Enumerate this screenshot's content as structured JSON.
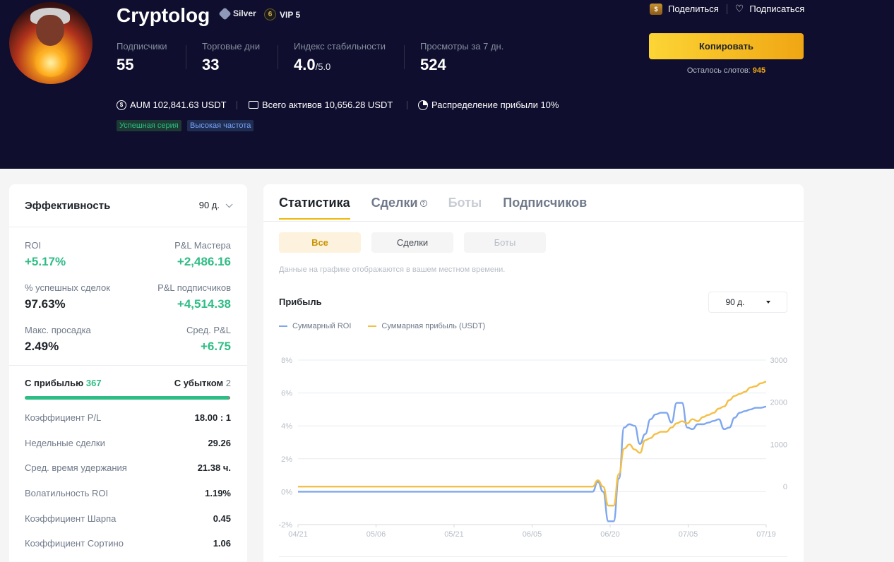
{
  "profile": {
    "name": "Cryptolog",
    "badge_silver": "Silver",
    "badge_vip": "VIP 5",
    "badge_vip_number": "6",
    "stats": [
      {
        "label": "Подписчики",
        "value": "55"
      },
      {
        "label": "Торговые дни",
        "value": "33"
      },
      {
        "label": "Индекс стабильности",
        "value": "4.0",
        "suffix": "/5.0"
      },
      {
        "label": "Просмотры за 7 дн.",
        "value": "524"
      }
    ],
    "aum": "AUM 102,841.63 USDT",
    "total_assets": "Всего активов 10,656.28 USDT",
    "profit_share": "Распределение прибыли 10%",
    "tags": [
      "Успешная серия",
      "Высокая частота"
    ]
  },
  "actions": {
    "share": "Поделиться",
    "subscribe": "Подписаться",
    "copy": "Копировать",
    "slots_label": "Осталось слотов: ",
    "slots_value": "945"
  },
  "performance": {
    "title": "Эффективность",
    "period": "90 д.",
    "metrics": [
      {
        "label": "ROI",
        "value": "+5.17%",
        "positive": true
      },
      {
        "label": "P&L Мастера",
        "value": "+2,486.16",
        "positive": true
      },
      {
        "label": "% успешных сделок",
        "value": "97.63%",
        "positive": false
      },
      {
        "label": "P&L подписчиков",
        "value": "+4,514.38",
        "positive": true
      },
      {
        "label": "Макс. просадка",
        "value": "2.49%",
        "positive": false
      },
      {
        "label": "Сред. P&L",
        "value": "+6.75",
        "positive": true
      }
    ],
    "profit_label": "С прибылью",
    "profit_count": "367",
    "loss_label": "С убытком",
    "loss_count": "2",
    "profit_fraction": 0.9946,
    "details": [
      {
        "label": "Коэффициент P/L",
        "value": "18.00 : 1"
      },
      {
        "label": "Недельные сделки",
        "value": "29.26"
      },
      {
        "label": "Сред. время удержания",
        "value": "21.38 ч."
      },
      {
        "label": "Волатильность ROI",
        "value": "1.19%"
      },
      {
        "label": "Коэффициент Шарпа",
        "value": "0.45"
      },
      {
        "label": "Коэффициент Сортино",
        "value": "1.06"
      }
    ]
  },
  "stats_panel": {
    "tabs": [
      "Статистика",
      "Сделки",
      "Боты",
      "Подписчиков"
    ],
    "segments": [
      "Все",
      "Сделки",
      "Боты"
    ],
    "note": "Данные на графике отображаются в вашем местном времени.",
    "chart_title": "Прибыль",
    "period": "90 д."
  },
  "colors": {
    "roi": "#7ea7ee",
    "profit": "#f4bf45",
    "green": "#2ebd85",
    "accent": "#f0b90b"
  },
  "chart_data": {
    "type": "line",
    "x_ticks": [
      "04/21",
      "05/06",
      "05/21",
      "06/05",
      "06/20",
      "07/05",
      "07/19"
    ],
    "x_range": [
      "2024-04-21",
      "2024-07-19"
    ],
    "y_left_ticks": [
      "8%",
      "6%",
      "4%",
      "2%",
      "0%",
      "-2%"
    ],
    "y_left_range": [
      -2,
      8
    ],
    "y_right_ticks": [
      "3000",
      "2000",
      "1000",
      "0"
    ],
    "y_right_range": [
      -900,
      3000
    ],
    "grid": true,
    "legend_position": "top-left",
    "series": [
      {
        "name": "Суммарный ROI",
        "axis": "left",
        "points": [
          [
            "2024-04-21",
            0
          ],
          [
            "2024-06-16",
            0
          ],
          [
            "2024-06-17",
            0.6
          ],
          [
            "2024-06-18",
            0
          ],
          [
            "2024-06-19",
            -1.8
          ],
          [
            "2024-06-20",
            -1.8
          ],
          [
            "2024-06-21",
            0.8
          ],
          [
            "2024-06-22",
            3.9
          ],
          [
            "2024-06-23",
            4.1
          ],
          [
            "2024-06-24",
            4.0
          ],
          [
            "2024-06-25",
            2.9
          ],
          [
            "2024-06-26",
            3.5
          ],
          [
            "2024-06-27",
            4.4
          ],
          [
            "2024-06-28",
            4.7
          ],
          [
            "2024-06-29",
            4.8
          ],
          [
            "2024-06-30",
            4.8
          ],
          [
            "2024-07-01",
            4.2
          ],
          [
            "2024-07-02",
            5.4
          ],
          [
            "2024-07-03",
            5.4
          ],
          [
            "2024-07-04",
            3.9
          ],
          [
            "2024-07-05",
            3.8
          ],
          [
            "2024-07-06",
            4.1
          ],
          [
            "2024-07-07",
            4.1
          ],
          [
            "2024-07-08",
            4.2
          ],
          [
            "2024-07-09",
            4.3
          ],
          [
            "2024-07-10",
            4.4
          ],
          [
            "2024-07-11",
            3.8
          ],
          [
            "2024-07-12",
            3.9
          ],
          [
            "2024-07-13",
            4.5
          ],
          [
            "2024-07-14",
            4.8
          ],
          [
            "2024-07-15",
            4.9
          ],
          [
            "2024-07-16",
            5.0
          ],
          [
            "2024-07-17",
            5.1
          ],
          [
            "2024-07-18",
            5.1
          ],
          [
            "2024-07-19",
            5.17
          ]
        ]
      },
      {
        "name": "Суммарная прибыль (USDT)",
        "axis": "right",
        "points": [
          [
            "2024-04-21",
            0
          ],
          [
            "2024-06-16",
            0
          ],
          [
            "2024-06-17",
            150
          ],
          [
            "2024-06-18",
            0
          ],
          [
            "2024-06-19",
            -450
          ],
          [
            "2024-06-20",
            -450
          ],
          [
            "2024-06-21",
            300
          ],
          [
            "2024-06-22",
            900
          ],
          [
            "2024-06-23",
            1000
          ],
          [
            "2024-06-24",
            880
          ],
          [
            "2024-06-25",
            800
          ],
          [
            "2024-06-26",
            1100
          ],
          [
            "2024-06-27",
            1150
          ],
          [
            "2024-06-28",
            1250
          ],
          [
            "2024-06-29",
            1300
          ],
          [
            "2024-06-30",
            1300
          ],
          [
            "2024-07-01",
            1400
          ],
          [
            "2024-07-02",
            1500
          ],
          [
            "2024-07-03",
            1550
          ],
          [
            "2024-07-04",
            1500
          ],
          [
            "2024-07-05",
            1600
          ],
          [
            "2024-07-06",
            1550
          ],
          [
            "2024-07-07",
            1650
          ],
          [
            "2024-07-08",
            1700
          ],
          [
            "2024-07-09",
            1750
          ],
          [
            "2024-07-10",
            1850
          ],
          [
            "2024-07-11",
            1900
          ],
          [
            "2024-07-12",
            2050
          ],
          [
            "2024-07-13",
            2150
          ],
          [
            "2024-07-14",
            2200
          ],
          [
            "2024-07-15",
            2250
          ],
          [
            "2024-07-16",
            2350
          ],
          [
            "2024-07-17",
            2380
          ],
          [
            "2024-07-18",
            2450
          ],
          [
            "2024-07-19",
            2486.16
          ]
        ]
      }
    ]
  }
}
